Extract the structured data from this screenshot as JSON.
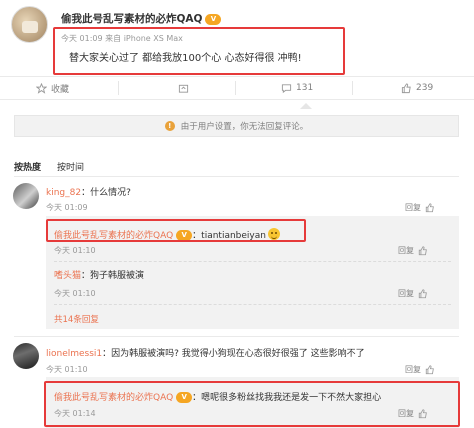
{
  "post": {
    "author": "偷我此号乱写素材的必炸QAQ",
    "vip_badge": "V",
    "time": "今天 01:09",
    "source_prefix": "来自",
    "source": "iPhone XS Max",
    "text": "替大家关心过了 都给我放100个心 心态好得很 冲鸭!"
  },
  "actions": {
    "favorite": "收藏",
    "forward_count": "",
    "comment_count": "131",
    "like_count": "239"
  },
  "notice": "由于用户设置，你无法回复评论。",
  "sort": {
    "hot": "按热度",
    "time": "按时间"
  },
  "comments": [
    {
      "user": "king_82",
      "text": "：什么情况?",
      "time": "今天 01:09",
      "reply_label": "回复",
      "replies": [
        {
          "user": "偷我此号乱写素材的必炸QAQ",
          "text": "：tiantianbeiyan",
          "time": "今天 01:10",
          "reply_label": "回复"
        },
        {
          "user": "嗜头猫",
          "text": "：狗子韩服被演",
          "time": "今天 01:10",
          "reply_label": "回复"
        }
      ],
      "more": "共14条回复"
    },
    {
      "user": "lionelmessi1",
      "text": "：因为韩服被演吗? 我觉得小狗现在心态很好很强了 这些影响不了",
      "time": "今天 01:10",
      "reply_label": "回复",
      "replies": [
        {
          "user": "偷我此号乱写素材的必炸QAQ",
          "text": "：嗯呢很多粉丝找我我还是发一下不然大家担心",
          "time": "今天 01:14",
          "reply_label": "回复"
        }
      ]
    }
  ],
  "colors": {
    "username": "#eb7350",
    "highlight": "#e63a3a",
    "reply_bg": "#f2f2f2"
  }
}
